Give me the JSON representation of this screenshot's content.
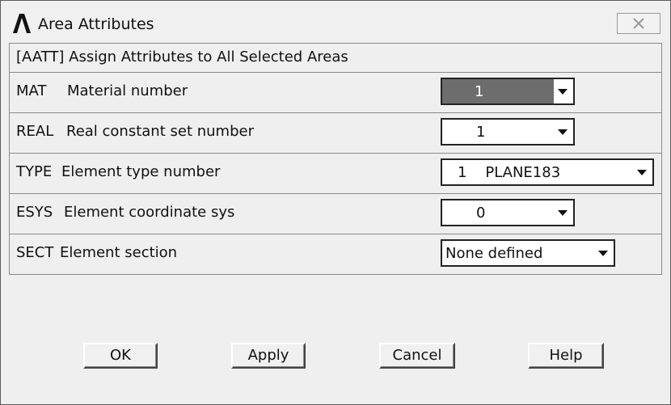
{
  "window": {
    "title": "Area Attributes",
    "icon": "ansys-logo-icon"
  },
  "header": {
    "text": "[AATT]  Assign Attributes to All Selected Areas"
  },
  "fields": [
    {
      "key": "MAT",
      "label": "Material number",
      "value": "1"
    },
    {
      "key": "REAL",
      "label": "Real constant set number",
      "value": "1"
    },
    {
      "key": "TYPE",
      "label": "Element type number",
      "value": "1    PLANE183"
    },
    {
      "key": "ESYS",
      "label": "Element coordinate sys",
      "value": "0"
    },
    {
      "key": "SECT",
      "label": "Element section",
      "value": "None defined"
    }
  ],
  "buttons": {
    "ok": "OK",
    "apply": "Apply",
    "cancel": "Cancel",
    "help": "Help"
  }
}
